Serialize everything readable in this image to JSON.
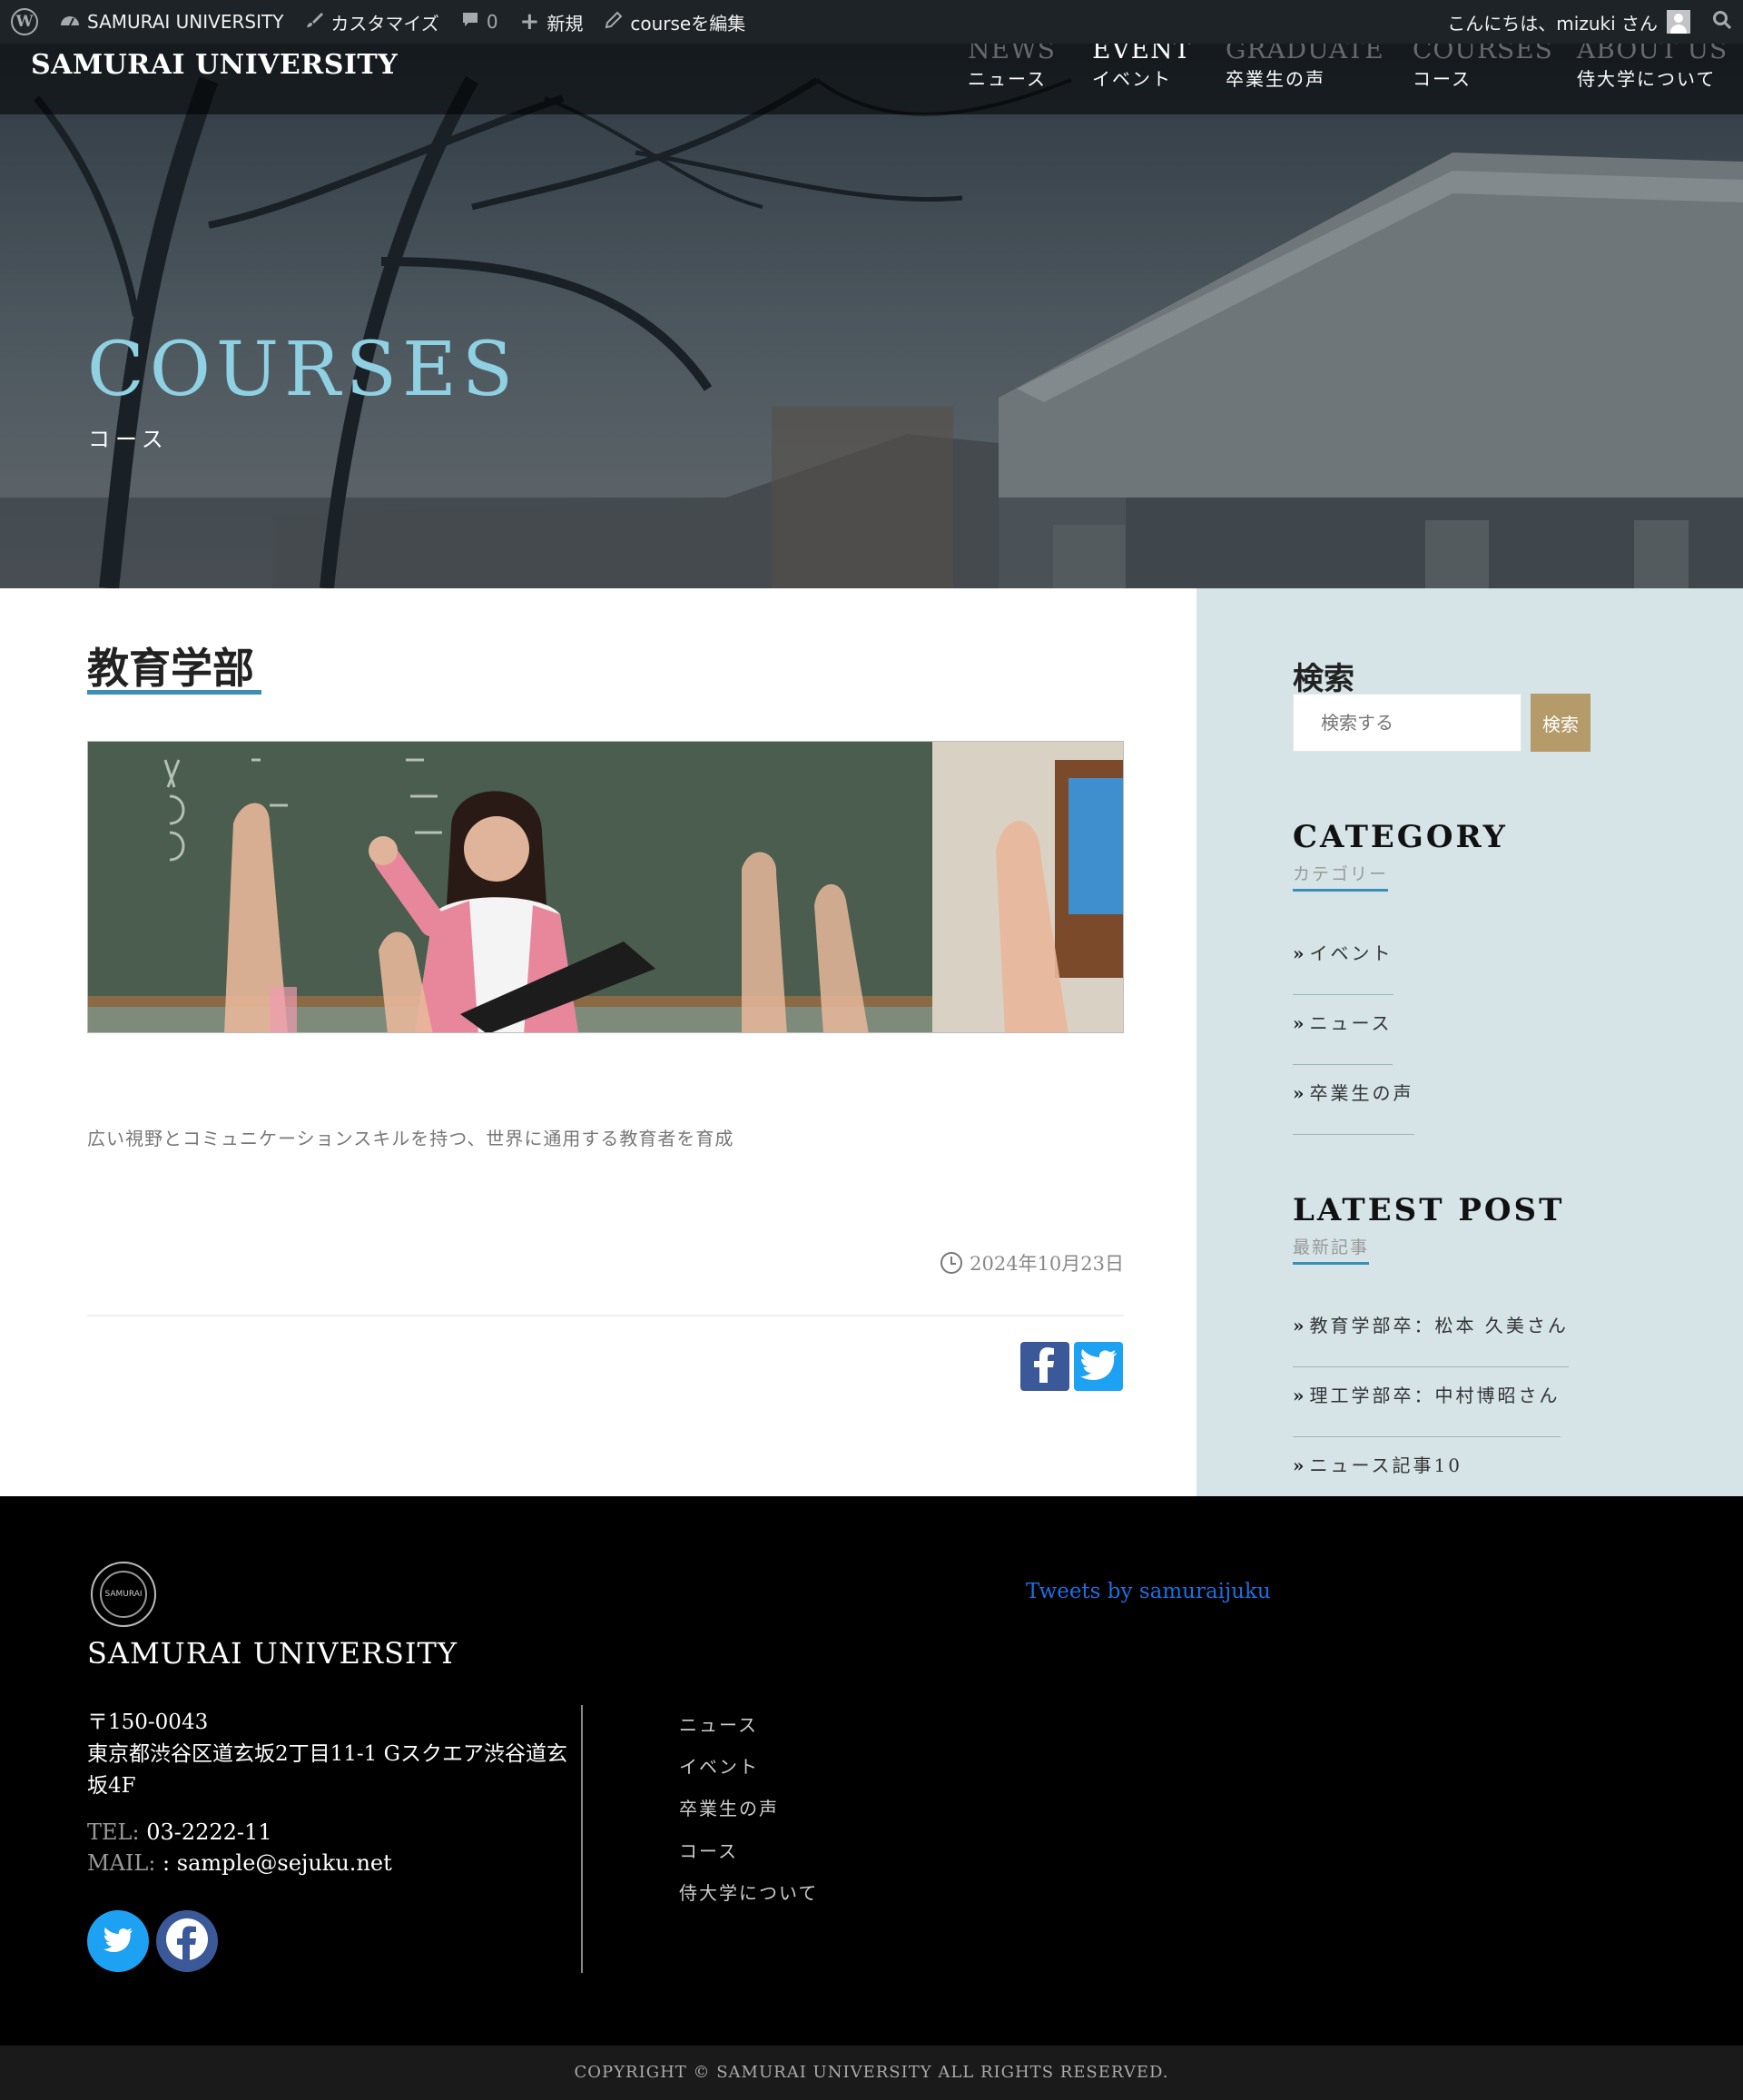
{
  "adminbar": {
    "site_name": "SAMURAI UNIVERSITY",
    "customize": "カスタマイズ",
    "comments_count": "0",
    "new": "新規",
    "edit": "courseを編集",
    "greeting": "こんにちは、mizuki さん",
    "icons": [
      "wordpress-icon",
      "dashboard-icon",
      "brush-icon",
      "comment-icon",
      "plus-icon",
      "pencil-icon",
      "search-icon"
    ]
  },
  "header": {
    "site_title": "SAMURAI UNIVERSITY",
    "nav": [
      {
        "en": "NEWS",
        "ja": "ニュース"
      },
      {
        "en": "EVENT",
        "ja": "イベント"
      },
      {
        "en": "GRADUATE",
        "ja": "卒業生の声"
      },
      {
        "en": "COURSES",
        "ja": "コース"
      },
      {
        "en": "ABOUT US",
        "ja": "侍大学について"
      }
    ]
  },
  "hero": {
    "title": "COURSES",
    "subtitle": "コース"
  },
  "post": {
    "title": "教育学部",
    "text": "広い視野とコミュニケーションスキルを持つ、世界に通用する教育者を育成",
    "date": "2024年10月23日"
  },
  "sidebar": {
    "search_heading": "検索",
    "search_placeholder": "検索する",
    "search_button": "検索",
    "category_heading": "CATEGORY",
    "category_sub": "カテゴリー",
    "categories": [
      "イベント",
      "ニュース",
      "卒業生の声"
    ],
    "latest_heading": "LATEST POST",
    "latest_sub": "最新記事",
    "latest": [
      "教育学部卒：松本 久美さん",
      "理工学部卒：中村博昭さん",
      "ニュース記事10"
    ]
  },
  "footer": {
    "title": "SAMURAI UNIVERSITY",
    "logo_text": "SAMURAI",
    "zip": "〒150-0043",
    "address": "東京都渋谷区道玄坂2丁目11-1 Gスクエア渋谷道玄坂4F",
    "tel_label": "TEL:",
    "tel": " 03-2222-11",
    "mail_label": "MAIL:",
    "mail": " : sample@sejuku.net",
    "nav": [
      "ニュース",
      "イベント",
      "卒業生の声",
      "コース",
      "侍大学について"
    ],
    "tweets_link": "Tweets by samuraijuku",
    "copyright": "COPYRIGHT © SAMURAI UNIVERSITY ALL RIGHTS RESERVED."
  },
  "colors": {
    "accent": "#3a8fb7",
    "hero_title": "#8fd0e3",
    "search_button": "#b59a6a",
    "sidebar_bg": "#d6e4e7",
    "facebook": "#3b5998",
    "twitter": "#1da1f2"
  }
}
